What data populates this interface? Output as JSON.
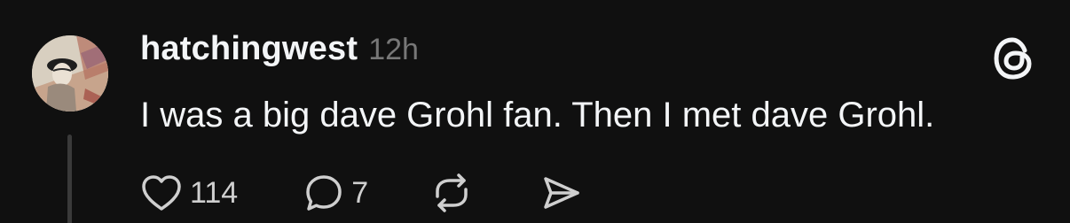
{
  "post": {
    "username": "hatchingwest",
    "timestamp": "12h",
    "text": "I was a big dave Grohl fan. Then I met dave Grohl.",
    "likes": "114",
    "replies": "7"
  },
  "icons": {
    "like": "heart-icon",
    "reply": "comment-icon",
    "repost": "repost-icon",
    "share": "send-icon",
    "logo": "threads-logo-icon"
  },
  "colors": {
    "background": "#101010",
    "text": "#f3f5f7",
    "muted": "#777777"
  }
}
